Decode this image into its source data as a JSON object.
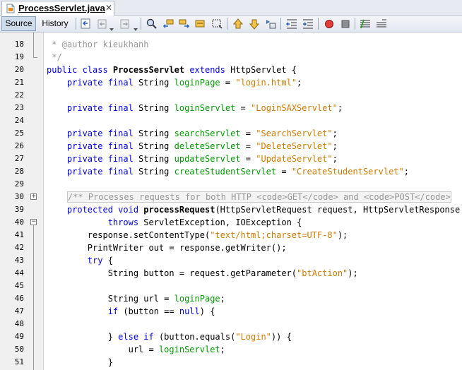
{
  "tab": {
    "title": "ProcessServlet.java",
    "close": "✕",
    "icon": "java-file-icon"
  },
  "toolbar": {
    "source_label": "Source",
    "history_label": "History",
    "icons": [
      "last-edit-icon",
      "back-icon",
      "forward-icon",
      "find-selection-icon",
      "find-previous-icon",
      "find-next-icon",
      "toggle-highlight-icon",
      "toggle-rect-selection-icon",
      "previous-bookmark-icon",
      "next-bookmark-icon",
      "toggle-bookmark-icon",
      "shift-left-icon",
      "shift-right-icon",
      "start-macro-icon",
      "stop-macro-icon",
      "comment-icon",
      "uncomment-icon"
    ]
  },
  "colors": {
    "keyword": "#0000e6",
    "string": "#ce7b00",
    "field": "#009900",
    "comment": "#969696"
  },
  "lines": [
    {
      "num": "18",
      "segs": [
        {
          "t": "cmt",
          "v": " * @author kieukhanh"
        }
      ]
    },
    {
      "num": "19",
      "segs": [
        {
          "t": "cmt",
          "v": " */"
        }
      ]
    },
    {
      "num": "20",
      "segs": [
        {
          "t": "kw",
          "v": "public class "
        },
        {
          "t": "mth",
          "v": "ProcessServlet"
        },
        {
          "t": "p",
          "v": " "
        },
        {
          "t": "kw",
          "v": "extends"
        },
        {
          "t": "p",
          "v": " HttpServlet {"
        }
      ]
    },
    {
      "num": "21",
      "segs": [
        {
          "t": "p",
          "v": "    "
        },
        {
          "t": "kw",
          "v": "private final"
        },
        {
          "t": "p",
          "v": " String "
        },
        {
          "t": "fld",
          "v": "loginPage"
        },
        {
          "t": "p",
          "v": " = "
        },
        {
          "t": "str",
          "v": "\"login.html\""
        },
        {
          "t": "p",
          "v": ";"
        }
      ]
    },
    {
      "num": "22",
      "segs": []
    },
    {
      "num": "23",
      "segs": [
        {
          "t": "p",
          "v": "    "
        },
        {
          "t": "kw",
          "v": "private final"
        },
        {
          "t": "p",
          "v": " String "
        },
        {
          "t": "fld",
          "v": "loginServlet"
        },
        {
          "t": "p",
          "v": " = "
        },
        {
          "t": "str",
          "v": "\"LoginSAXServlet\""
        },
        {
          "t": "p",
          "v": ";"
        }
      ]
    },
    {
      "num": "24",
      "segs": []
    },
    {
      "num": "25",
      "segs": [
        {
          "t": "p",
          "v": "    "
        },
        {
          "t": "kw",
          "v": "private final"
        },
        {
          "t": "p",
          "v": " String "
        },
        {
          "t": "fld",
          "v": "searchServlet"
        },
        {
          "t": "p",
          "v": " = "
        },
        {
          "t": "str",
          "v": "\"SearchServlet\""
        },
        {
          "t": "p",
          "v": ";"
        }
      ]
    },
    {
      "num": "26",
      "segs": [
        {
          "t": "p",
          "v": "    "
        },
        {
          "t": "kw",
          "v": "private final"
        },
        {
          "t": "p",
          "v": " String "
        },
        {
          "t": "fld",
          "v": "deleteServlet"
        },
        {
          "t": "p",
          "v": " = "
        },
        {
          "t": "str",
          "v": "\"DeleteServlet\""
        },
        {
          "t": "p",
          "v": ";"
        }
      ]
    },
    {
      "num": "27",
      "segs": [
        {
          "t": "p",
          "v": "    "
        },
        {
          "t": "kw",
          "v": "private final"
        },
        {
          "t": "p",
          "v": " String "
        },
        {
          "t": "fld",
          "v": "updateServlet"
        },
        {
          "t": "p",
          "v": " = "
        },
        {
          "t": "str",
          "v": "\"UpdateServlet\""
        },
        {
          "t": "p",
          "v": ";"
        }
      ]
    },
    {
      "num": "28",
      "segs": [
        {
          "t": "p",
          "v": "    "
        },
        {
          "t": "kw",
          "v": "private final"
        },
        {
          "t": "p",
          "v": " String "
        },
        {
          "t": "fld",
          "v": "createStudentServlet"
        },
        {
          "t": "p",
          "v": " = "
        },
        {
          "t": "str",
          "v": "\"CreateStudentServlet\""
        },
        {
          "t": "p",
          "v": ";"
        }
      ]
    },
    {
      "num": "29",
      "segs": []
    },
    {
      "num": "30",
      "segs": [
        {
          "t": "p",
          "v": "    "
        },
        {
          "t": "cmtf",
          "v": "/** Processes requests for both HTTP <code>GET</code> and <code>POST</code>"
        }
      ]
    },
    {
      "num": "39",
      "segs": [
        {
          "t": "p",
          "v": "    "
        },
        {
          "t": "kw",
          "v": "protected void "
        },
        {
          "t": "mth",
          "v": "processRequest"
        },
        {
          "t": "p",
          "v": "(HttpServletRequest request, HttpServletResponse response)"
        }
      ]
    },
    {
      "num": "40",
      "segs": [
        {
          "t": "p",
          "v": "            "
        },
        {
          "t": "kw",
          "v": "throws"
        },
        {
          "t": "p",
          "v": " ServletException, IOException {"
        }
      ]
    },
    {
      "num": "41",
      "segs": [
        {
          "t": "p",
          "v": "        response.setContentType("
        },
        {
          "t": "str",
          "v": "\"text/html;charset=UTF-8\""
        },
        {
          "t": "p",
          "v": ");"
        }
      ]
    },
    {
      "num": "42",
      "segs": [
        {
          "t": "p",
          "v": "        PrintWriter out = response.getWriter();"
        }
      ]
    },
    {
      "num": "43",
      "segs": [
        {
          "t": "p",
          "v": "        "
        },
        {
          "t": "kw",
          "v": "try"
        },
        {
          "t": "p",
          "v": " {"
        }
      ]
    },
    {
      "num": "44",
      "segs": [
        {
          "t": "p",
          "v": "            String button = request.getParameter("
        },
        {
          "t": "str",
          "v": "\"btAction\""
        },
        {
          "t": "p",
          "v": ");"
        }
      ]
    },
    {
      "num": "45",
      "segs": []
    },
    {
      "num": "46",
      "segs": [
        {
          "t": "p",
          "v": "            String url = "
        },
        {
          "t": "fld",
          "v": "loginPage"
        },
        {
          "t": "p",
          "v": ";"
        }
      ]
    },
    {
      "num": "47",
      "segs": [
        {
          "t": "p",
          "v": "            "
        },
        {
          "t": "kw",
          "v": "if"
        },
        {
          "t": "p",
          "v": " (button == "
        },
        {
          "t": "kw",
          "v": "null"
        },
        {
          "t": "p",
          "v": ") {"
        }
      ]
    },
    {
      "num": "48",
      "segs": []
    },
    {
      "num": "49",
      "segs": [
        {
          "t": "p",
          "v": "            } "
        },
        {
          "t": "kw",
          "v": "else if"
        },
        {
          "t": "p",
          "v": " (button.equals("
        },
        {
          "t": "str",
          "v": "\"Login\""
        },
        {
          "t": "p",
          "v": ")) {"
        }
      ]
    },
    {
      "num": "50",
      "segs": [
        {
          "t": "p",
          "v": "                url = "
        },
        {
          "t": "fld",
          "v": "loginServlet"
        },
        {
          "t": "p",
          "v": ";"
        }
      ]
    },
    {
      "num": "51",
      "segs": [
        {
          "t": "p",
          "v": "            }"
        }
      ]
    }
  ]
}
